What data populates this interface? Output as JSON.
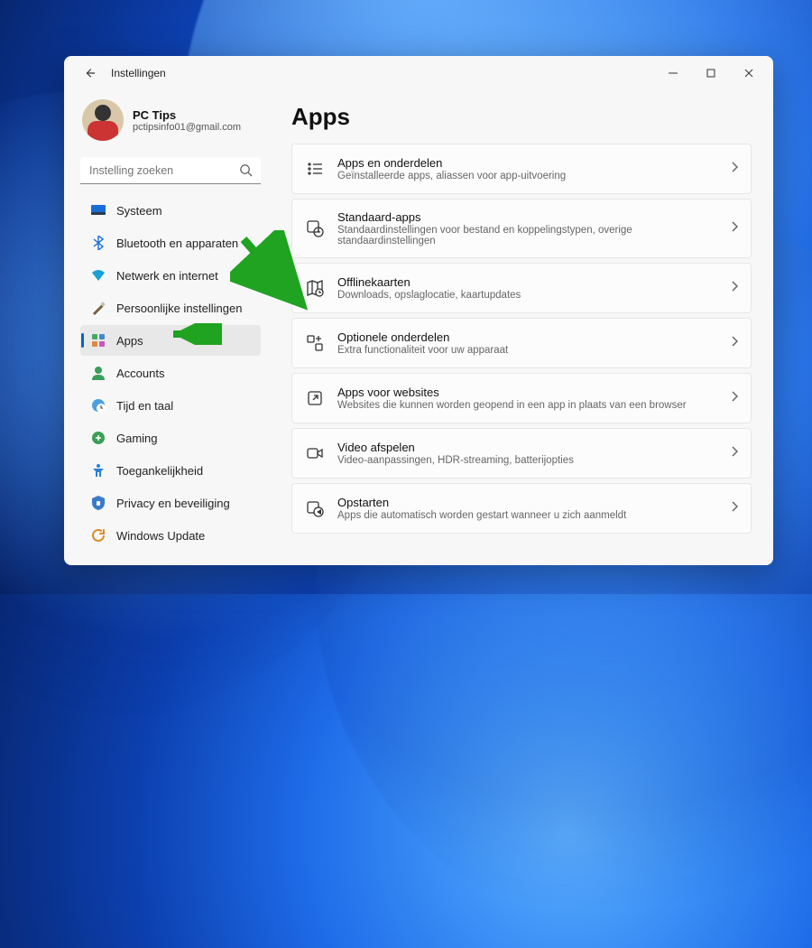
{
  "window": {
    "title": "Instellingen"
  },
  "profile": {
    "name": "PC Tips",
    "email": "pctipsinfo01@gmail.com"
  },
  "search": {
    "placeholder": "Instelling zoeken"
  },
  "nav": {
    "items": [
      {
        "label": "Systeem"
      },
      {
        "label": "Bluetooth en apparaten"
      },
      {
        "label": "Netwerk en internet"
      },
      {
        "label": "Persoonlijke instellingen"
      },
      {
        "label": "Apps"
      },
      {
        "label": "Accounts"
      },
      {
        "label": "Tijd en taal"
      },
      {
        "label": "Gaming"
      },
      {
        "label": "Toegankelijkheid"
      },
      {
        "label": "Privacy en beveiliging"
      },
      {
        "label": "Windows Update"
      }
    ],
    "active_index": 4
  },
  "page": {
    "title": "Apps"
  },
  "cards": [
    {
      "title": "Apps en onderdelen",
      "sub": "Geïnstalleerde apps, aliassen voor app-uitvoering"
    },
    {
      "title": "Standaard-apps",
      "sub": "Standaardinstellingen voor bestand en koppelingstypen, overige standaardinstellingen"
    },
    {
      "title": "Offlinekaarten",
      "sub": "Downloads, opslaglocatie, kaartupdates"
    },
    {
      "title": "Optionele onderdelen",
      "sub": "Extra functionaliteit voor uw apparaat"
    },
    {
      "title": "Apps voor websites",
      "sub": "Websites die kunnen worden geopend in een app in plaats van een browser"
    },
    {
      "title": "Video afspelen",
      "sub": "Video-aanpassingen, HDR-streaming, batterijopties"
    },
    {
      "title": "Opstarten",
      "sub": "Apps die automatisch worden gestart wanneer u zich aanmeldt"
    }
  ]
}
